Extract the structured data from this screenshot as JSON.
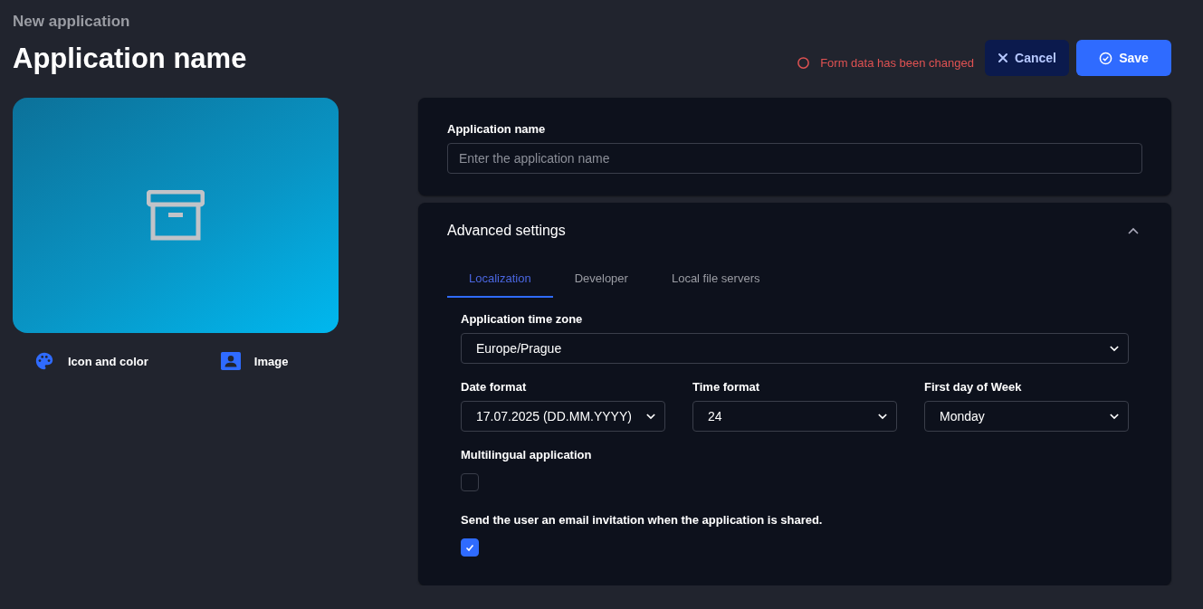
{
  "header": {
    "subtitle": "New application",
    "title": "Application name"
  },
  "status": {
    "text": "Form data has been changed"
  },
  "buttons": [
    {
      "kind": "cancel",
      "label": "Cancel"
    },
    {
      "kind": "save",
      "label": "Save"
    }
  ],
  "preview_options": [
    {
      "kind": "palette",
      "label": "Icon and color"
    },
    {
      "kind": "image",
      "label": "Image"
    }
  ],
  "name_card": {
    "label": "Application name",
    "placeholder": "Enter the application name"
  },
  "advanced": {
    "title": "Advanced settings",
    "expanded": true,
    "tabs": [
      {
        "label": "Localization",
        "selected": true
      },
      {
        "label": "Developer",
        "selected": false
      },
      {
        "label": "Local file servers",
        "selected": false
      }
    ],
    "timezone": {
      "label": "Application time zone",
      "value": "Europe/Prague"
    },
    "formats": [
      {
        "label": "Date format",
        "value": "17.07.2025 (DD.MM.YYYY)"
      },
      {
        "label": "Time format",
        "value": "24"
      },
      {
        "label": "First day of Week",
        "value": "Monday"
      }
    ],
    "checkboxes": [
      {
        "label": "Multilingual application",
        "checked": false
      },
      {
        "label": "Send the user an email invitation when the application is shared.",
        "checked": true
      }
    ]
  }
}
